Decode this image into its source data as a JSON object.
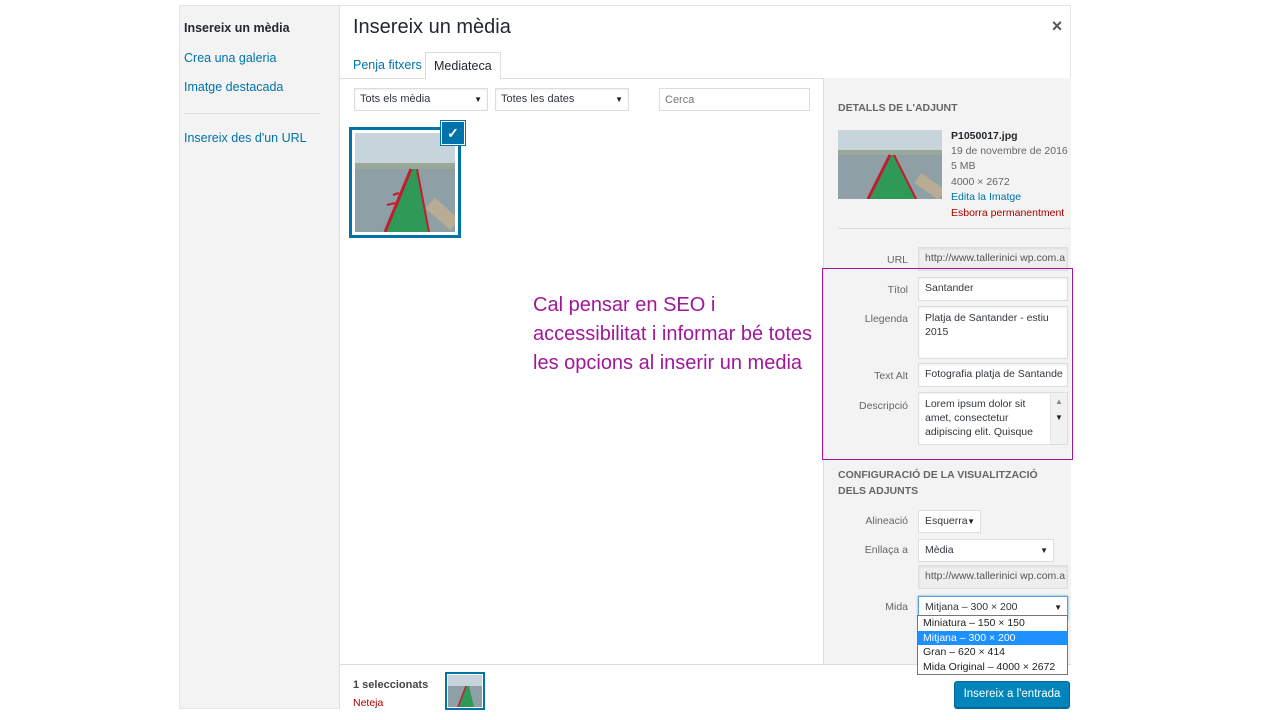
{
  "menu": {
    "items": [
      {
        "label": "Insereix un mèdia"
      },
      {
        "label": "Crea una galeria"
      },
      {
        "label": "Imatge destacada"
      },
      {
        "label": "Insereix des d'un URL"
      }
    ]
  },
  "frame": {
    "title": "Insereix un mèdia",
    "close_icon": "×",
    "tabs": [
      {
        "label": "Penja fitxers"
      },
      {
        "label": "Mediateca"
      }
    ]
  },
  "toolbar": {
    "type_filter": "Tots els mèdia",
    "date_filter": "Totes les dates",
    "search_placeholder": "Cerca"
  },
  "attachment": {
    "check_glyph": "✓"
  },
  "annotation": "Cal pensar en SEO i accessibilitat i informar bé totes les opcions al inserir un media",
  "details": {
    "heading": "Detalls de l'adjunt",
    "filename": "P1050017.jpg",
    "date": "19 de novembre de 2016",
    "size": "5 MB",
    "dimensions": "4000 × 2672",
    "edit_link": "Edita la Imatge",
    "delete_link": "Esborra permanentment",
    "fields": {
      "url_label": "URL",
      "url_value": "http://www.tallerinici wp.com.a",
      "title_label": "Títol",
      "title_value": "Santander",
      "caption_label": "Llegenda",
      "caption_value": "Platja de Santander - estiu 2015",
      "alt_label": "Text Alt",
      "alt_value": "Fotografia platja de Santande",
      "description_label": "Descripció",
      "description_value": "Lorem ipsum dolor sit amet, consectetur adipiscing elit. Quisque"
    }
  },
  "display_settings": {
    "heading": "Configuració de la visualització dels adjunts",
    "alignment_label": "Alineació",
    "alignment_value": "Esquerra",
    "link_label": "Enllaça a",
    "link_value": "Mèdia",
    "link_url": "http://www.tallerinici wp.com.a",
    "size_label": "Mida",
    "size_value": "Mitjana – 300 × 200",
    "size_options": [
      {
        "label": "Miniatura – 150 × 150",
        "selected": false
      },
      {
        "label": "Mitjana – 300 × 200",
        "selected": true
      },
      {
        "label": "Gran – 620 × 414",
        "selected": false
      },
      {
        "label": "Mida Original – 4000 × 2672",
        "selected": false
      }
    ]
  },
  "bottom": {
    "selected_count": "1 seleccionats",
    "clear_link": "Neteja",
    "insert_button": "Insereix a l'entrada"
  },
  "colors": {
    "accent": "#0073aa",
    "primary_button": "#0085ba",
    "annotation": "#a0179a",
    "delete": "#aa0000"
  },
  "icons": {
    "close": "close-icon",
    "check": "check-icon",
    "dropdown": "chevron-down-icon"
  }
}
